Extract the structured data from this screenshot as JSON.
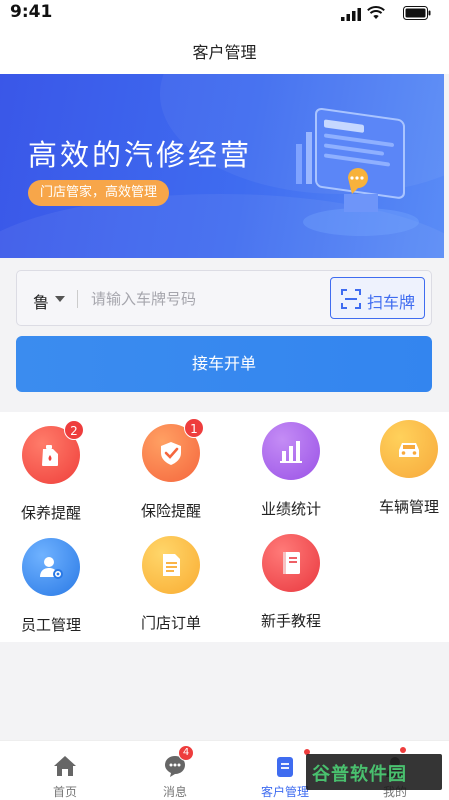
{
  "status_bar": {
    "time": "9:41"
  },
  "nav": {
    "title": "客户管理"
  },
  "banner": {
    "headline": "高效的汽修经营",
    "tagline": "门店管家，高效管理"
  },
  "search": {
    "province": "鲁",
    "placeholder": "请输入车牌号码",
    "value": "",
    "scan_label": "扫车牌"
  },
  "primary_button": {
    "label": "接车开单"
  },
  "features": [
    {
      "label": "保养提醒",
      "icon": "oil-can-icon",
      "badge": "2",
      "color": "#ef3f3b"
    },
    {
      "label": "保险提醒",
      "icon": "shield-check-icon",
      "badge": "1",
      "color": "#f5663d"
    },
    {
      "label": "业绩统计",
      "icon": "bar-chart-icon",
      "color": "#9a52e6"
    },
    {
      "label": "车辆管理",
      "icon": "car-icon",
      "color": "#f7a93c"
    },
    {
      "label": "员工管理",
      "icon": "staff-settings-icon",
      "color": "#2a79e5"
    },
    {
      "label": "门店订单",
      "icon": "document-icon",
      "color": "#f9ac32"
    },
    {
      "label": "新手教程",
      "icon": "book-icon",
      "color": "#e9383f"
    }
  ],
  "tabs": [
    {
      "label": "首页",
      "icon": "home-icon"
    },
    {
      "label": "消息",
      "icon": "chat-icon",
      "badge": "4"
    },
    {
      "label": "客户管理",
      "icon": "clipboard-icon",
      "active": true
    },
    {
      "label": "我的",
      "icon": "user-icon"
    }
  ],
  "watermark": {
    "text": "谷普软件园"
  },
  "colors": {
    "accent": "#3f6cf0",
    "button": "#3385ef",
    "badge": "#ee3d3d",
    "pill": "#f7a64a"
  }
}
